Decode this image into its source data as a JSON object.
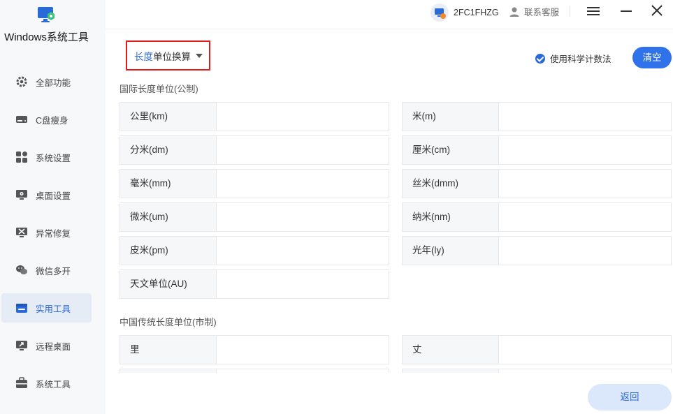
{
  "app": {
    "title": "Windows系统工具"
  },
  "sidebar": {
    "items": [
      {
        "label": "全部功能",
        "icon": "gear-icon"
      },
      {
        "label": "C盘瘦身",
        "icon": "drive-icon"
      },
      {
        "label": "系统设置",
        "icon": "grid-icon"
      },
      {
        "label": "桌面设置",
        "icon": "monitor-gear-icon"
      },
      {
        "label": "异常修复",
        "icon": "repair-icon"
      },
      {
        "label": "微信多开",
        "icon": "wechat-icon"
      },
      {
        "label": "实用工具",
        "icon": "toolbox-icon",
        "active": true
      },
      {
        "label": "远程桌面",
        "icon": "remote-desktop-icon"
      },
      {
        "label": "系统工具",
        "icon": "briefcase-icon"
      }
    ]
  },
  "titlebar": {
    "device_name": "2FC1FHZG",
    "support_label": "联系客服"
  },
  "toolbar": {
    "dropdown_accent": "长度",
    "dropdown_rest": "单位换算",
    "sci_label": "使用科学计数法",
    "clear_label": "清空"
  },
  "sections": {
    "metric_title": "国际长度单位(公制)",
    "chinese_title": "中国传统长度单位(市制)"
  },
  "metric_units": [
    {
      "label": "公里(km)",
      "value": ""
    },
    {
      "label": "米(m)",
      "value": ""
    },
    {
      "label": "分米(dm)",
      "value": ""
    },
    {
      "label": "厘米(cm)",
      "value": ""
    },
    {
      "label": "毫米(mm)",
      "value": ""
    },
    {
      "label": "丝米(dmm)",
      "value": ""
    },
    {
      "label": "微米(um)",
      "value": ""
    },
    {
      "label": "纳米(nm)",
      "value": ""
    },
    {
      "label": "皮米(pm)",
      "value": ""
    },
    {
      "label": "光年(ly)",
      "value": ""
    },
    {
      "label": "天文单位(AU)",
      "value": ""
    }
  ],
  "chinese_units": [
    {
      "label": "里",
      "value": ""
    },
    {
      "label": "丈",
      "value": ""
    },
    {
      "label": "",
      "value": ""
    },
    {
      "label": "",
      "value": ""
    }
  ],
  "footer": {
    "back_label": "返回"
  },
  "colors": {
    "accent": "#2a69d8",
    "highlight_border": "#e01b1b",
    "active_bg": "#e6ecf6"
  }
}
